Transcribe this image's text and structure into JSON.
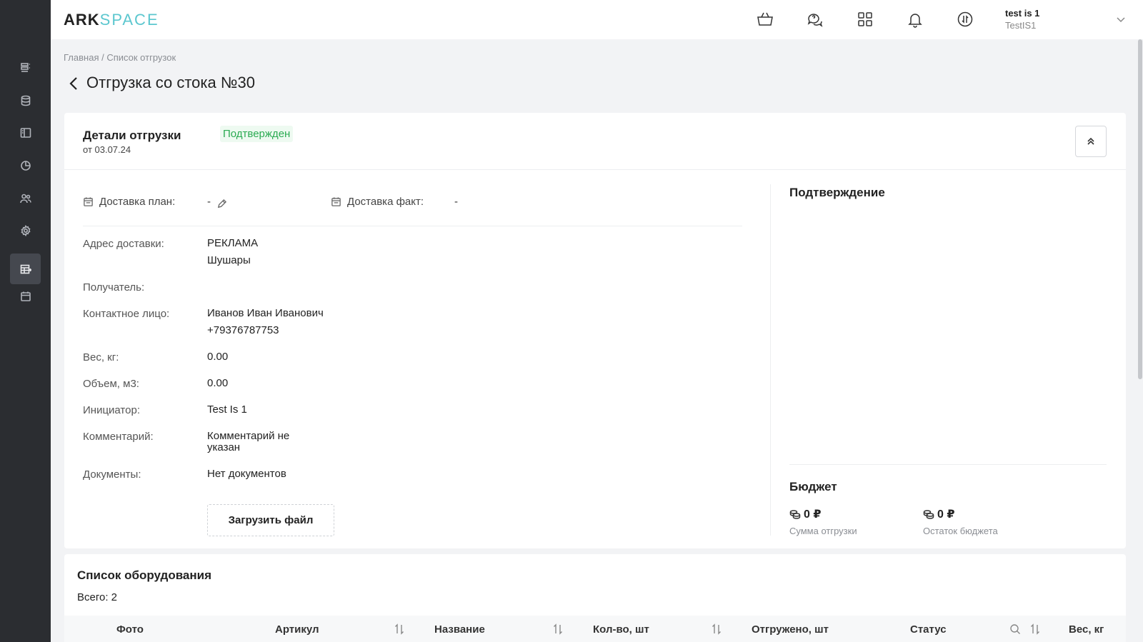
{
  "app": {
    "logo_part1": "ARK",
    "logo_part2": "SPACE"
  },
  "user": {
    "name": "test is 1",
    "org": "TestIS1"
  },
  "breadcrumb": "Главная / Список отгрузок",
  "page_title": "Отгрузка со стока №30",
  "details": {
    "title": "Детали отгрузки",
    "date": "от 03.07.24",
    "status": "Подтвержден",
    "delivery_plan_label": "Доставка план:",
    "delivery_plan_value": "-",
    "delivery_fact_label": "Доставка факт:",
    "delivery_fact_value": "-",
    "fields": {
      "address_label": "Адрес доставки:",
      "address_line1": "РЕКЛАМА",
      "address_line2": "Шушары",
      "recipient_label": "Получатель:",
      "contact_label": "Контактное лицо:",
      "contact_name": "Иванов Иван Иванович",
      "contact_phone": "+79376787753",
      "weight_label": "Вес, кг:",
      "weight_value": "0.00",
      "volume_label": "Объем, м3:",
      "volume_value": "0.00",
      "initiator_label": "Инициатор:",
      "initiator_value": "Test Is 1",
      "comment_label": "Комментарий:",
      "comment_line1": "Комментарий не",
      "comment_line2": "указан",
      "docs_label": "Документы:",
      "docs_value": "Нет документов"
    },
    "upload_label": "Загрузить файл",
    "confirmation_title": "Подтверждение",
    "budget_title": "Бюджет",
    "shipment_sum": "0 ₽",
    "shipment_sum_caption": "Сумма отгрузки",
    "budget_rest": "0 ₽",
    "budget_rest_caption": "Остаток бюджета"
  },
  "equipment": {
    "title": "Список оборудования",
    "total": "Всего: 2",
    "columns": [
      "Фото",
      "Артикул",
      "Название",
      "Кол-во, шт",
      "Отгружено, шт",
      "Статус",
      "Вес, кг"
    ]
  },
  "colors": {
    "sidebar": "#2b2d31",
    "accent": "#5cc7cf",
    "status_green": "#2bab52"
  },
  "icons": {
    "sidebar": [
      "list-icon",
      "database-icon",
      "panel-icon",
      "chart-pie-icon",
      "users-icon",
      "gear-icon",
      "table-icon",
      "calendar-icon"
    ],
    "header": [
      "basket-icon",
      "chat-icon",
      "grid-icon",
      "bell-icon",
      "sync-icon"
    ]
  }
}
